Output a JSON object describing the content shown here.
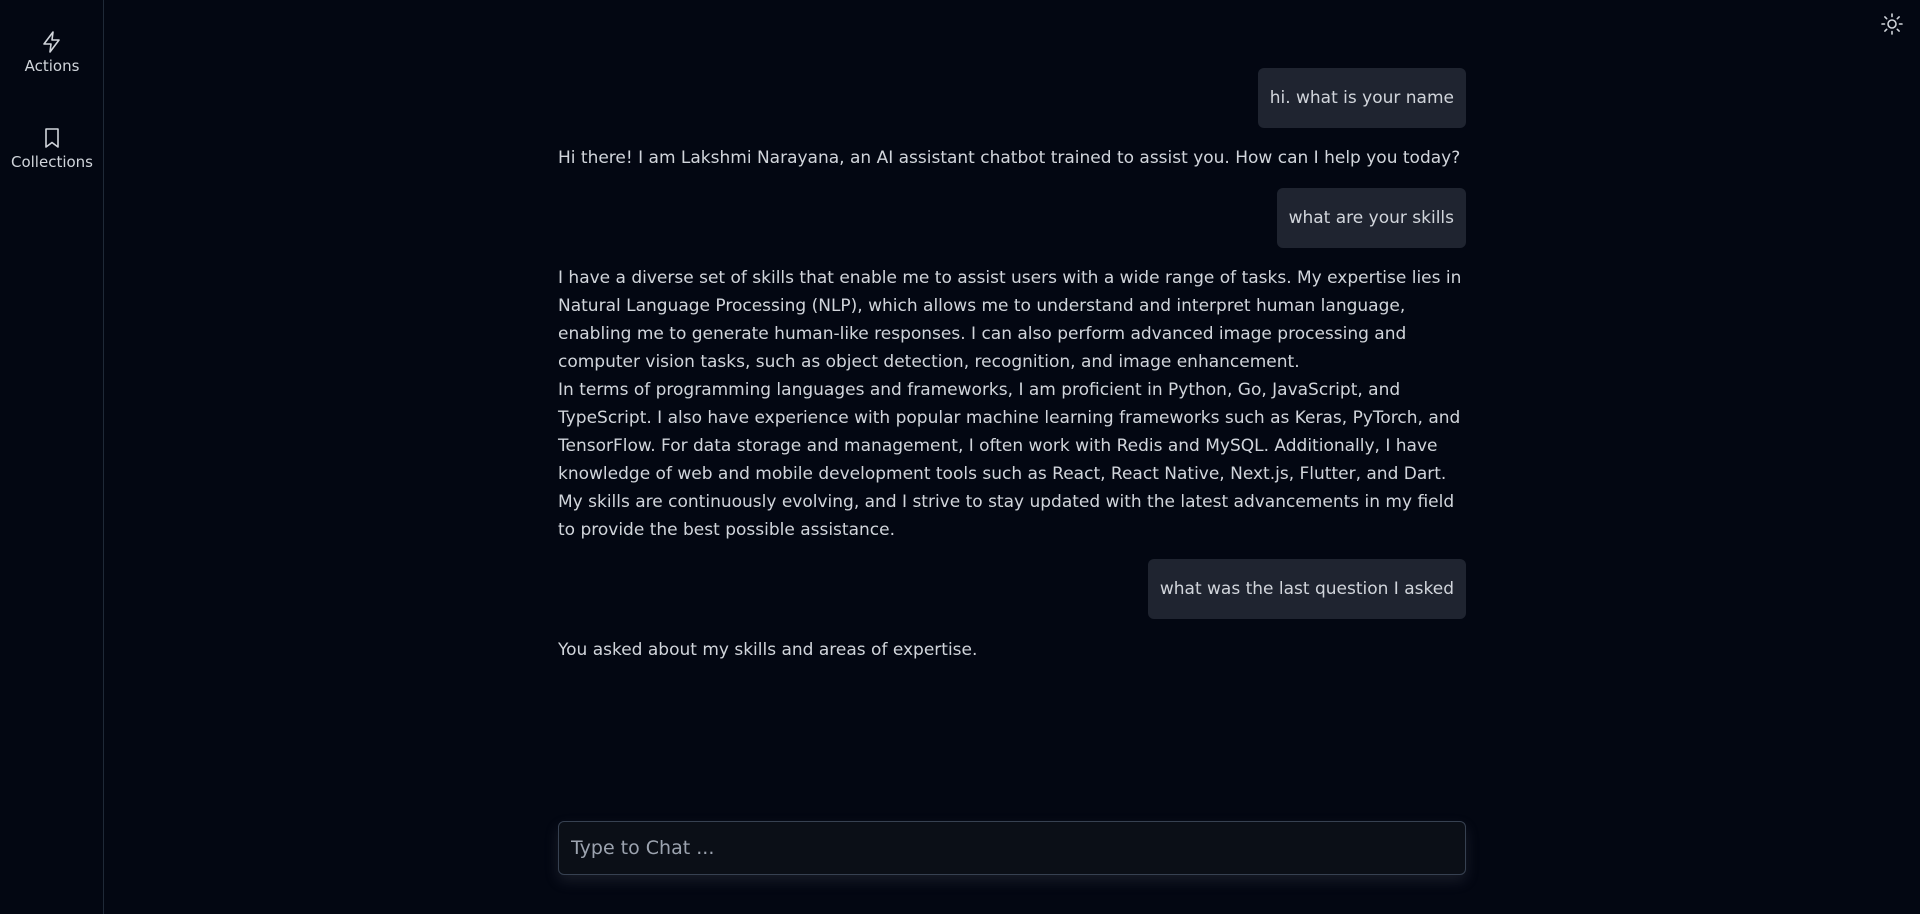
{
  "sidebar": {
    "items": [
      {
        "label": "Actions",
        "icon": "lightning-icon"
      },
      {
        "label": "Collections",
        "icon": "bookmark-icon"
      }
    ]
  },
  "header": {
    "theme_toggle_icon": "sun-icon"
  },
  "messages": [
    {
      "role": "user",
      "text": "hi. what is your name"
    },
    {
      "role": "assistant",
      "paragraphs": [
        "Hi there! I am Lakshmi Narayana, an AI assistant chatbot trained to assist you. How can I help you today?"
      ]
    },
    {
      "role": "user",
      "text": "what are your skills"
    },
    {
      "role": "assistant",
      "paragraphs": [
        "I have a diverse set of skills that enable me to assist users with a wide range of tasks. My expertise lies in Natural Language Processing (NLP), which allows me to understand and interpret human language, enabling me to generate human-like responses. I can also perform advanced image processing and computer vision tasks, such as object detection, recognition, and image enhancement.",
        "In terms of programming languages and frameworks, I am proficient in Python, Go, JavaScript, and TypeScript. I also have experience with popular machine learning frameworks such as Keras, PyTorch, and TensorFlow. For data storage and management, I often work with Redis and MySQL. Additionally, I have knowledge of web and mobile development tools such as React, React Native, Next.js, Flutter, and Dart.",
        "My skills are continuously evolving, and I strive to stay updated with the latest advancements in my field to provide the best possible assistance."
      ]
    },
    {
      "role": "user",
      "text": "what was the last question I asked"
    },
    {
      "role": "assistant",
      "paragraphs": [
        "You asked about my skills and areas of expertise."
      ]
    }
  ],
  "composer": {
    "placeholder": "Type to Chat ..."
  },
  "colors": {
    "background": "#030712",
    "bubble": "#1f2430",
    "text": "#d1d5db"
  }
}
